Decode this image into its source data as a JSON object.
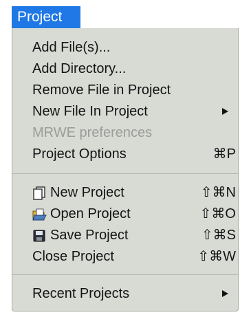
{
  "menu": {
    "title": "Project",
    "items": [
      {
        "label": "Add File(s)..."
      },
      {
        "label": "Add Directory..."
      },
      {
        "label": "Remove File in Project"
      },
      {
        "label": "New File In Project",
        "submenu": true
      },
      {
        "label": "MRWE preferences",
        "disabled": true
      },
      {
        "label": "Project Options",
        "shortcut": "⌘P"
      },
      {
        "label": "New Project",
        "shortcut": "⇧⌘N",
        "icon": "new-document-icon"
      },
      {
        "label": "Open Project",
        "shortcut": "⇧⌘O",
        "icon": "open-folder-icon"
      },
      {
        "label": "Save Project",
        "shortcut": "⇧⌘S",
        "icon": "save-disk-icon"
      },
      {
        "label": "Close Project",
        "shortcut": "⇧⌘W"
      },
      {
        "label": "Recent Projects",
        "submenu": true
      }
    ]
  },
  "colors": {
    "highlight": "#1f78e6",
    "menu_background": "#d7dbd4",
    "disabled_text": "#9a9d98"
  }
}
